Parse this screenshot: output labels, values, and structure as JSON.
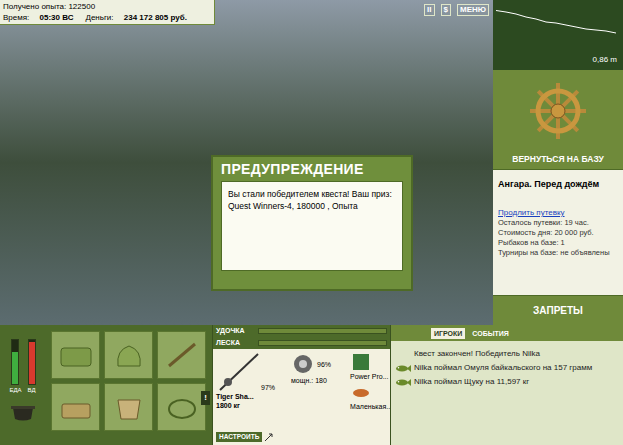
{
  "status": {
    "experience_label": "Получено опыта:",
    "experience": "122500",
    "time_label": "Время:",
    "time": "05:30 ВС",
    "money_label": "Деньги:",
    "money": "234 172 805 руб."
  },
  "top_buttons": [
    "II",
    "$",
    "МЕНЮ"
  ],
  "depth": {
    "reading": "0,86 m",
    "profile": [
      0.05,
      0.08,
      0.12,
      0.18,
      0.22,
      0.28,
      0.3,
      0.34,
      0.38,
      0.42,
      0.44,
      0.46,
      0.5
    ]
  },
  "dialog": {
    "title": "ПРЕДУПРЕЖДЕНИЕ",
    "message": "Вы стали победителем квеста! Ваш приз: Quest Winners-4, 180000 , Опыта"
  },
  "return_button": "ВЕРНУТЬСЯ НА БАЗУ",
  "location": {
    "title": "Ангара. Перед дождём",
    "extend_link": "Продлить путевку",
    "details": [
      "Осталось путевки: 19 час.",
      "Стоимость дня: 20 000 руб.",
      "Рыбаков на базе: 1",
      "Турниры на базе: не объявлены"
    ]
  },
  "bans_button": "ЗАПРЕТЫ",
  "meters": [
    {
      "label": "ЕДА",
      "level": 0.72,
      "color": "#3fae3f"
    },
    {
      "label": "ВД",
      "level": 0.95,
      "color": "#d83a2e"
    }
  ],
  "inventory_alert": "!",
  "tackle": {
    "rod_label": "УДОЧКА",
    "rod_level": 0.0,
    "line_label": "ЛЕСКА",
    "line_level": 0.0,
    "rod": {
      "name": "Tiger Sha...",
      "capacity": "1800 кг",
      "wear": "97%"
    },
    "reel": {
      "power": "мощн.: 180",
      "wear": "96%"
    },
    "line": {
      "name": "Power Pro..."
    },
    "lure": {
      "name": "Маленькая..."
    },
    "setup_button": "НАСТРОИТЬ"
  },
  "tabs": [
    {
      "label": "ИГРОКИ",
      "selected": true
    },
    {
      "label": "СОБЫТИЯ",
      "selected": false
    }
  ],
  "events": [
    {
      "kind": "quest",
      "text": "Квест закончен! Победитель Nilka"
    },
    {
      "kind": "catch",
      "text": "Nilka поймал Омуля байкальского на 157 грамм"
    },
    {
      "kind": "catch",
      "text": "Nilka поймал Щуку на 11,597 кг"
    }
  ]
}
